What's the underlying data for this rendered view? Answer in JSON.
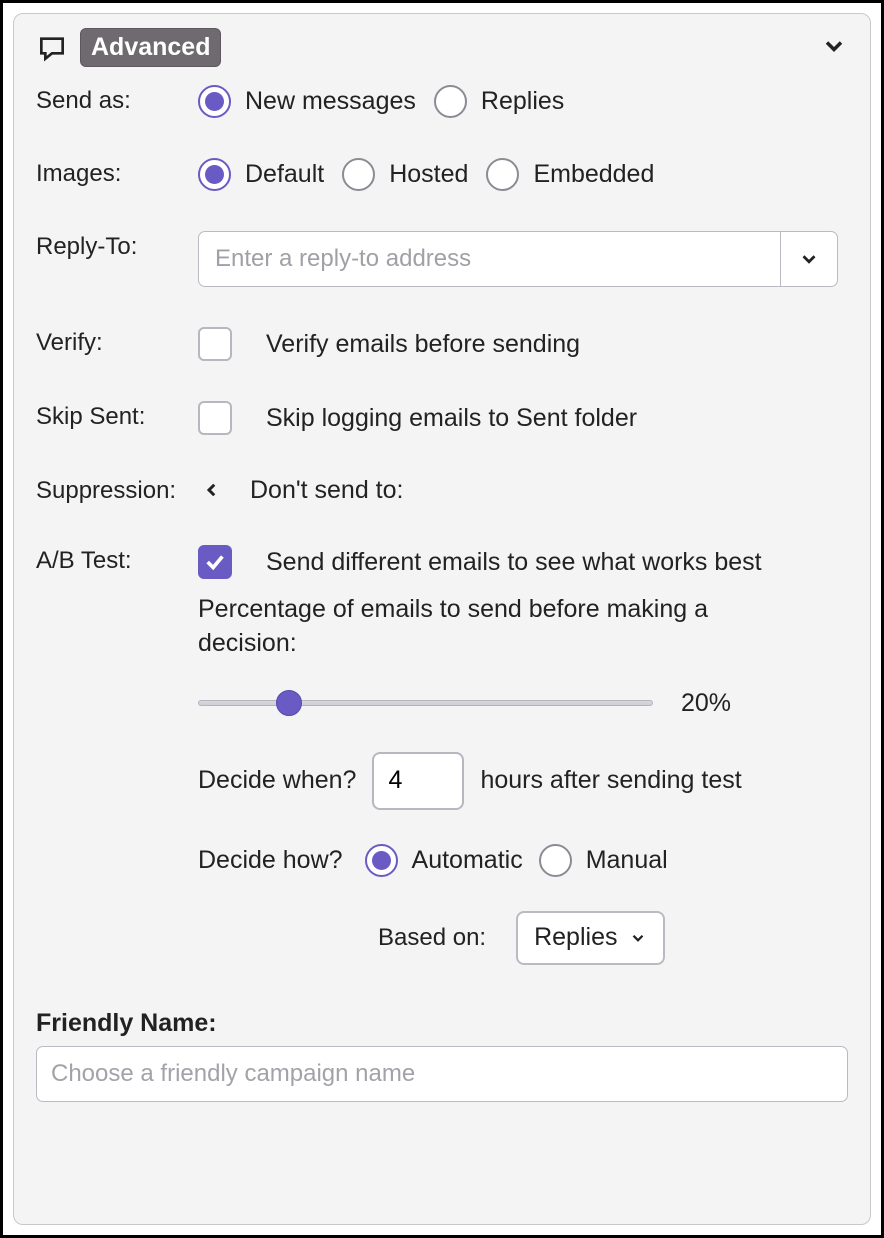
{
  "header": {
    "badge": "Advanced"
  },
  "sendAs": {
    "label": "Send as:",
    "options": {
      "newMessages": "New messages",
      "replies": "Replies"
    },
    "selected": "newMessages"
  },
  "images": {
    "label": "Images:",
    "options": {
      "default": "Default",
      "hosted": "Hosted",
      "embedded": "Embedded"
    },
    "selected": "default"
  },
  "replyTo": {
    "label": "Reply-To:",
    "placeholder": "Enter a reply-to address",
    "value": ""
  },
  "verify": {
    "label": "Verify:",
    "text": "Verify emails before sending",
    "checked": false
  },
  "skipSent": {
    "label": "Skip Sent:",
    "text": "Skip logging emails to Sent folder",
    "checked": false
  },
  "suppression": {
    "label": "Suppression:",
    "text": "Don't send to:"
  },
  "abTest": {
    "label": "A/B Test:",
    "text": "Send different emails to see what works best",
    "checked": true,
    "percentage": {
      "label": "Percentage of emails to send before making a decision:",
      "value": 20,
      "display": "20%"
    },
    "decideWhen": {
      "question": "Decide when?",
      "value": "4",
      "suffix": "hours after sending test"
    },
    "decideHow": {
      "question": "Decide how?",
      "options": {
        "automatic": "Automatic",
        "manual": "Manual"
      },
      "selected": "automatic"
    },
    "basedOn": {
      "label": "Based on:",
      "value": "Replies"
    }
  },
  "friendlyName": {
    "label": "Friendly Name:",
    "placeholder": "Choose a friendly campaign name",
    "value": ""
  }
}
